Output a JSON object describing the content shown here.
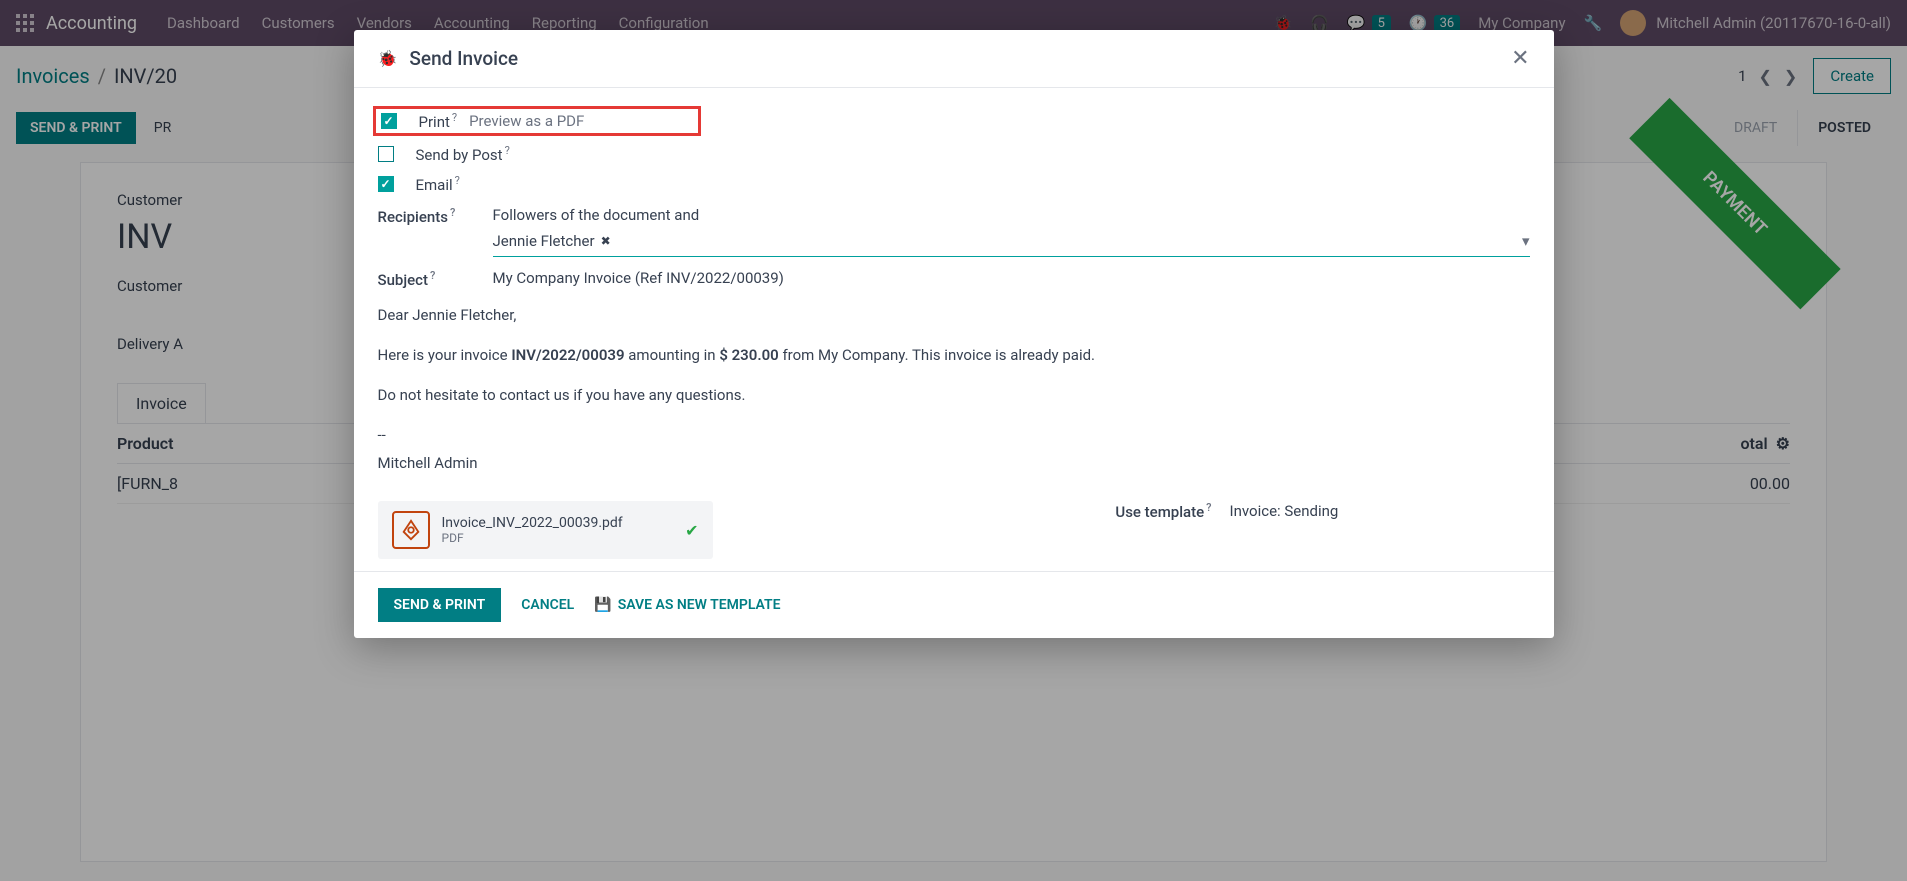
{
  "navbar": {
    "module": "Accounting",
    "menus": [
      "Dashboard",
      "Customers",
      "Vendors",
      "Accounting",
      "Reporting",
      "Configuration"
    ],
    "msg_count": "5",
    "activity_count": "36",
    "company": "My Company",
    "user": "Mitchell Admin (20117670-16-0-all)"
  },
  "breadcrumb": {
    "root": "Invoices",
    "current": "INV/20",
    "pager": "1",
    "create": "Create"
  },
  "actions": {
    "send_print": "SEND & PRINT",
    "preview": "PR",
    "status_draft": "DRAFT",
    "status_posted": "POSTED"
  },
  "sheet": {
    "customer_label": "Customer",
    "title_prefix": "INV",
    "customer2": "Customer",
    "delivery": "Delivery A",
    "tab_invoice": "Invoice",
    "col_product": "Product",
    "col_subtotal": "otal",
    "row_product": "[FURN_8",
    "row_subtotal": "00.00",
    "ribbon": "PAYMENT"
  },
  "modal": {
    "title": "Send Invoice",
    "opt_print": "Print",
    "opt_print_hint": "Preview as a PDF",
    "opt_post": "Send by Post",
    "opt_email": "Email",
    "recipients_label": "Recipients",
    "recipients_intro": "Followers of the document and",
    "recipient_chip": "Jennie Fletcher",
    "subject_label": "Subject",
    "subject_value": "My Company Invoice (Ref INV/2022/00039)",
    "body_greeting": "Dear Jennie Fletcher,",
    "body_line_pre": "Here is your invoice ",
    "body_inv": "INV/2022/00039",
    "body_mid": " amounting in ",
    "body_amt": "$ 230.00",
    "body_post": " from My Company. This invoice is already paid.",
    "body_q": "Do not hesitate to contact us if you have any questions.",
    "body_dash": "--",
    "body_sign": "Mitchell Admin",
    "attach_name": "Invoice_INV_2022_00039.pdf",
    "attach_type": "PDF",
    "tmpl_label": "Use template",
    "tmpl_value": "Invoice: Sending",
    "btn_send": "SEND & PRINT",
    "btn_cancel": "CANCEL",
    "btn_save_tmpl": "SAVE AS NEW TEMPLATE"
  }
}
